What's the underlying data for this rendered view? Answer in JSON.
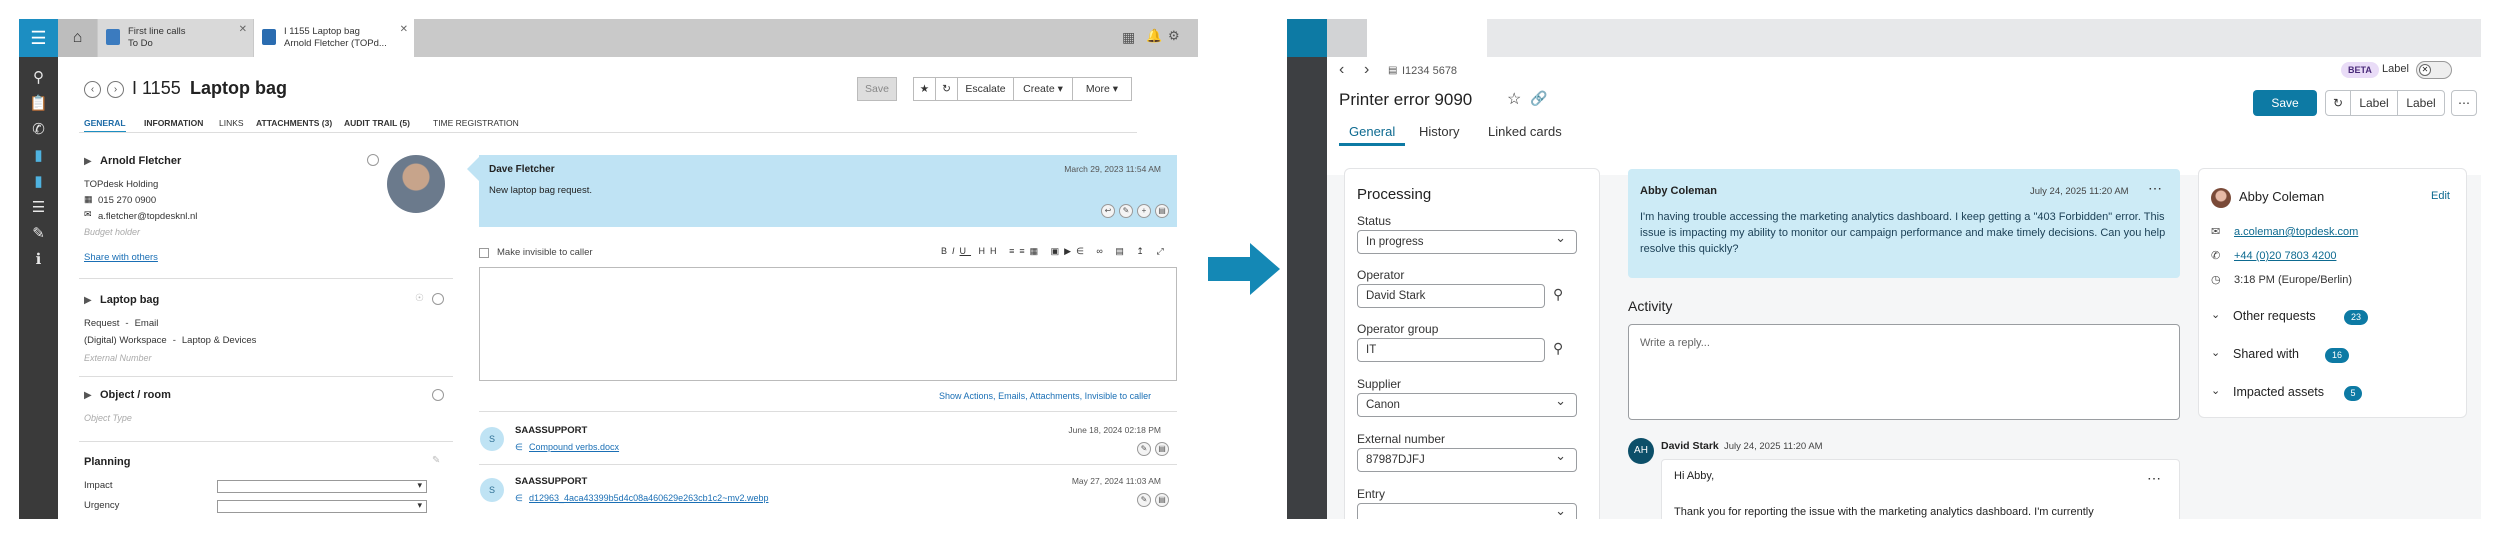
{
  "old_ui": {
    "tabs": [
      {
        "line1": "First line calls",
        "line2": "To Do"
      },
      {
        "line1": "I 1155 Laptop bag",
        "line2": "Arnold Fletcher (TOPd..."
      }
    ],
    "ticket_number": "I 1155",
    "ticket_title": "Laptop bag",
    "toolbar": {
      "save": "Save",
      "escalate": "Escalate",
      "create": "Create",
      "more": "More"
    },
    "subtabs": [
      "GENERAL",
      "INFORMATION",
      "LINKS",
      "ATTACHMENTS (3)",
      "AUDIT TRAIL (5)",
      "TIME REGISTRATION"
    ],
    "caller": {
      "name": "Arnold Fletcher",
      "company": "TOPdesk Holding",
      "phone": "015 270 0900",
      "email": "a.fletcher@topdesknl.nl",
      "budget_placeholder": "Budget holder",
      "share_link": "Share with others"
    },
    "request": {
      "title": "Laptop bag",
      "line1_a": "Request",
      "line1_b": "Email",
      "line2_a": "(Digital) Workspace",
      "line2_b": "Laptop & Devices",
      "external_placeholder": "External Number"
    },
    "object": {
      "title": "Object / room",
      "placeholder": "Object Type"
    },
    "planning": {
      "title": "Planning",
      "impact_label": "Impact",
      "urgency_label": "Urgency"
    },
    "message": {
      "author": "Dave Fletcher",
      "date": "March 29, 2023 11:54 AM",
      "text": "New laptop bag request."
    },
    "editor": {
      "invisible_label": "Make invisible to caller",
      "show_links": {
        "prefix": "Show ",
        "a": "Actions",
        "b": "Emails",
        "c": "Attachments",
        "d": "Invisible to caller"
      }
    },
    "entries": [
      {
        "author": "SAASSUPPORT",
        "date": "June 18, 2024 02:18 PM",
        "file": "Compound verbs.docx"
      },
      {
        "author": "SAASSUPPORT",
        "date": "May 27, 2024 11:03 AM",
        "file": "d12963_4aca43399b5d4c08a460629e263cb1c2~mv2.webp"
      }
    ]
  },
  "new_ui": {
    "breadcrumb_id": "I1234 5678",
    "title": "Printer error 9090",
    "beta_badge": "BETA",
    "label_toggle": "Label",
    "save_button": "Save",
    "label_buttons": [
      "Label",
      "Label"
    ],
    "tabs": [
      "General",
      "History",
      "Linked cards"
    ],
    "processing": {
      "title": "Processing",
      "fields": [
        {
          "label": "Status",
          "value": "In progress",
          "kind": "dropdown"
        },
        {
          "label": "Operator",
          "value": "David Stark",
          "kind": "search"
        },
        {
          "label": "Operator group",
          "value": "IT",
          "kind": "search"
        },
        {
          "label": "Supplier",
          "value": "Canon",
          "kind": "dropdown"
        },
        {
          "label": "External number",
          "value": "87987DJFJ",
          "kind": "dropdown"
        },
        {
          "label": "Entry",
          "value": "",
          "kind": "dropdown"
        }
      ]
    },
    "message": {
      "author": "Abby Coleman",
      "date": "July 24, 2025 11:20 AM",
      "text": "I'm having trouble accessing the marketing analytics dashboard. I keep getting a \"403 Forbidden\" error. This issue is impacting my ability to monitor our campaign performance and make timely decisions. Can you help resolve this quickly?"
    },
    "activity": {
      "title": "Activity",
      "reply_placeholder": "Write a reply...",
      "reply": {
        "initials": "AH",
        "author": "David Stark",
        "date": "July 24, 2025 11:20 AM",
        "greeting": "Hi Abby,",
        "text": "Thank you for reporting the issue with the marketing analytics dashboard. I'm currently"
      }
    },
    "contact": {
      "name": "Abby Coleman",
      "edit": "Edit",
      "email": "a.coleman@topdesk.com",
      "phone": "+44 (0)20 7803 4200",
      "time": "3:18 PM (Europe/Berlin)",
      "sections": [
        {
          "label": "Other requests",
          "count": "23"
        },
        {
          "label": "Shared with",
          "count": "16"
        },
        {
          "label": "Impacted assets",
          "count": "5"
        }
      ]
    }
  },
  "colors": {
    "old_accent": "#1c8ec2",
    "old_message_bg": "#bfe3f4",
    "new_accent": "#0d7aa4",
    "new_message_bg": "#cdebf6",
    "arrow": "#1488b5"
  }
}
